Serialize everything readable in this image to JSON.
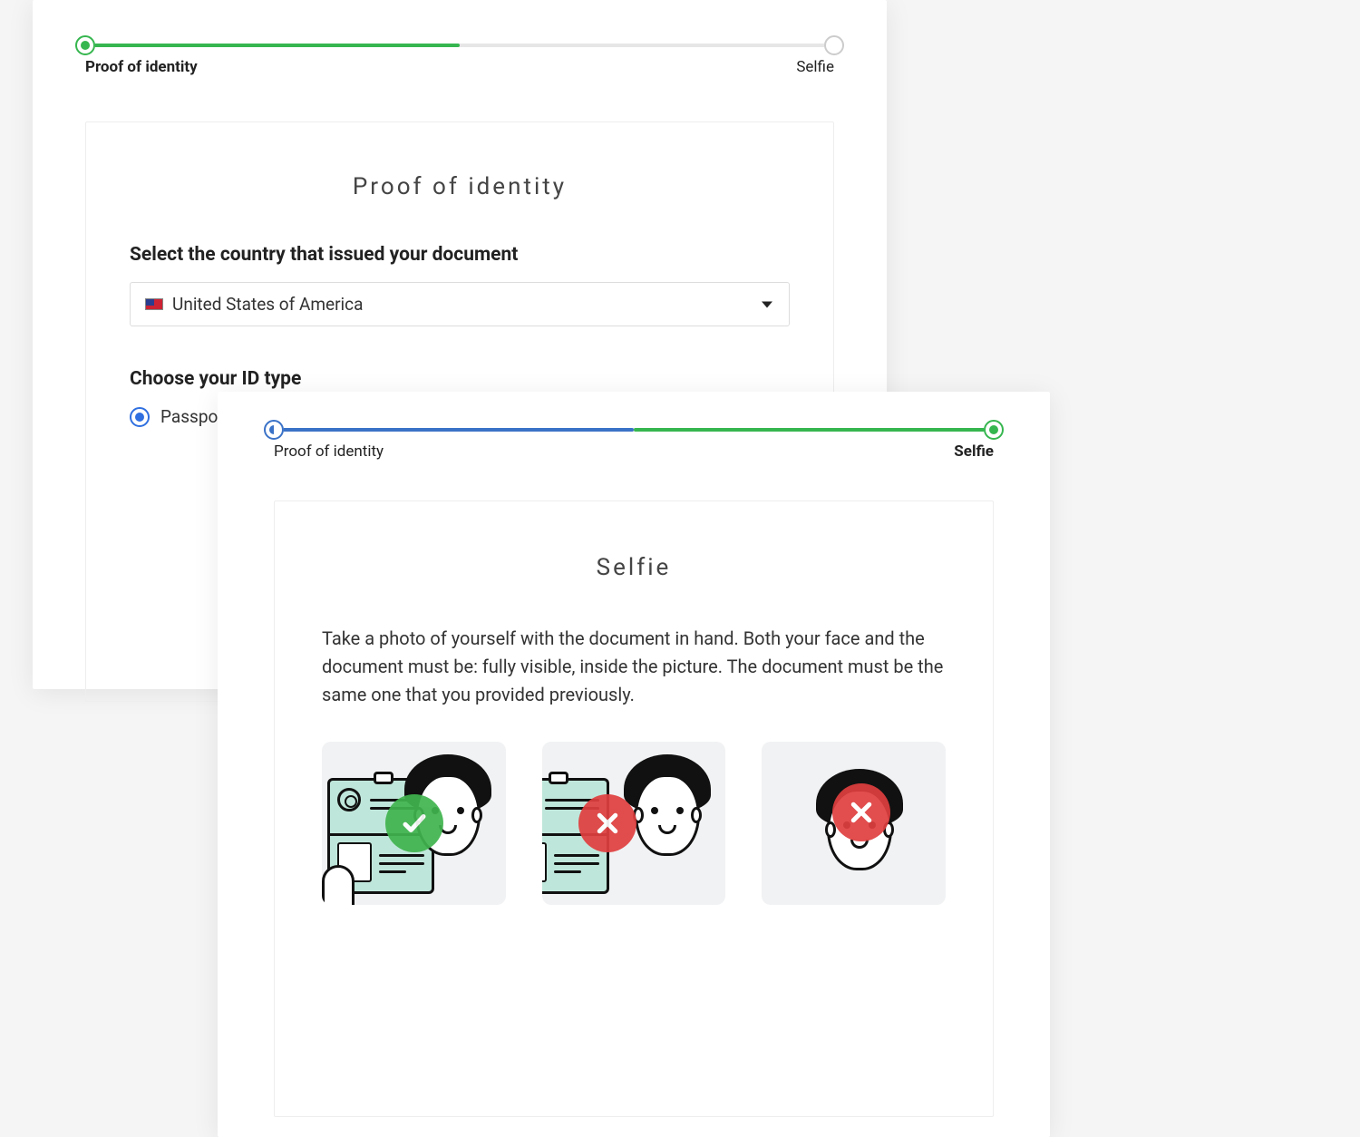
{
  "identity_step": {
    "progress_labels": {
      "left": "Proof of identity",
      "right": "Selfie"
    },
    "panel_title": "Proof of identity",
    "country_label": "Select the country that issued your document",
    "country_value": "United States of America",
    "id_type_label": "Choose your ID type",
    "id_option_passport": "Passport"
  },
  "selfie_step": {
    "progress_labels": {
      "left": "Proof of identity",
      "right": "Selfie"
    },
    "panel_title": "Selfie",
    "instructions": "Take a photo of yourself with the document in hand. Both your face and the document must be: fully visible, inside the picture. The document must be the same one that you provided previously.",
    "examples": {
      "good": "correct",
      "bad_cropped_doc": "document-cropped",
      "bad_no_doc": "no-document"
    }
  },
  "colors": {
    "accent_blue": "#3a72c7",
    "accent_green": "#36b64f",
    "error_red": "#e03e3e"
  }
}
